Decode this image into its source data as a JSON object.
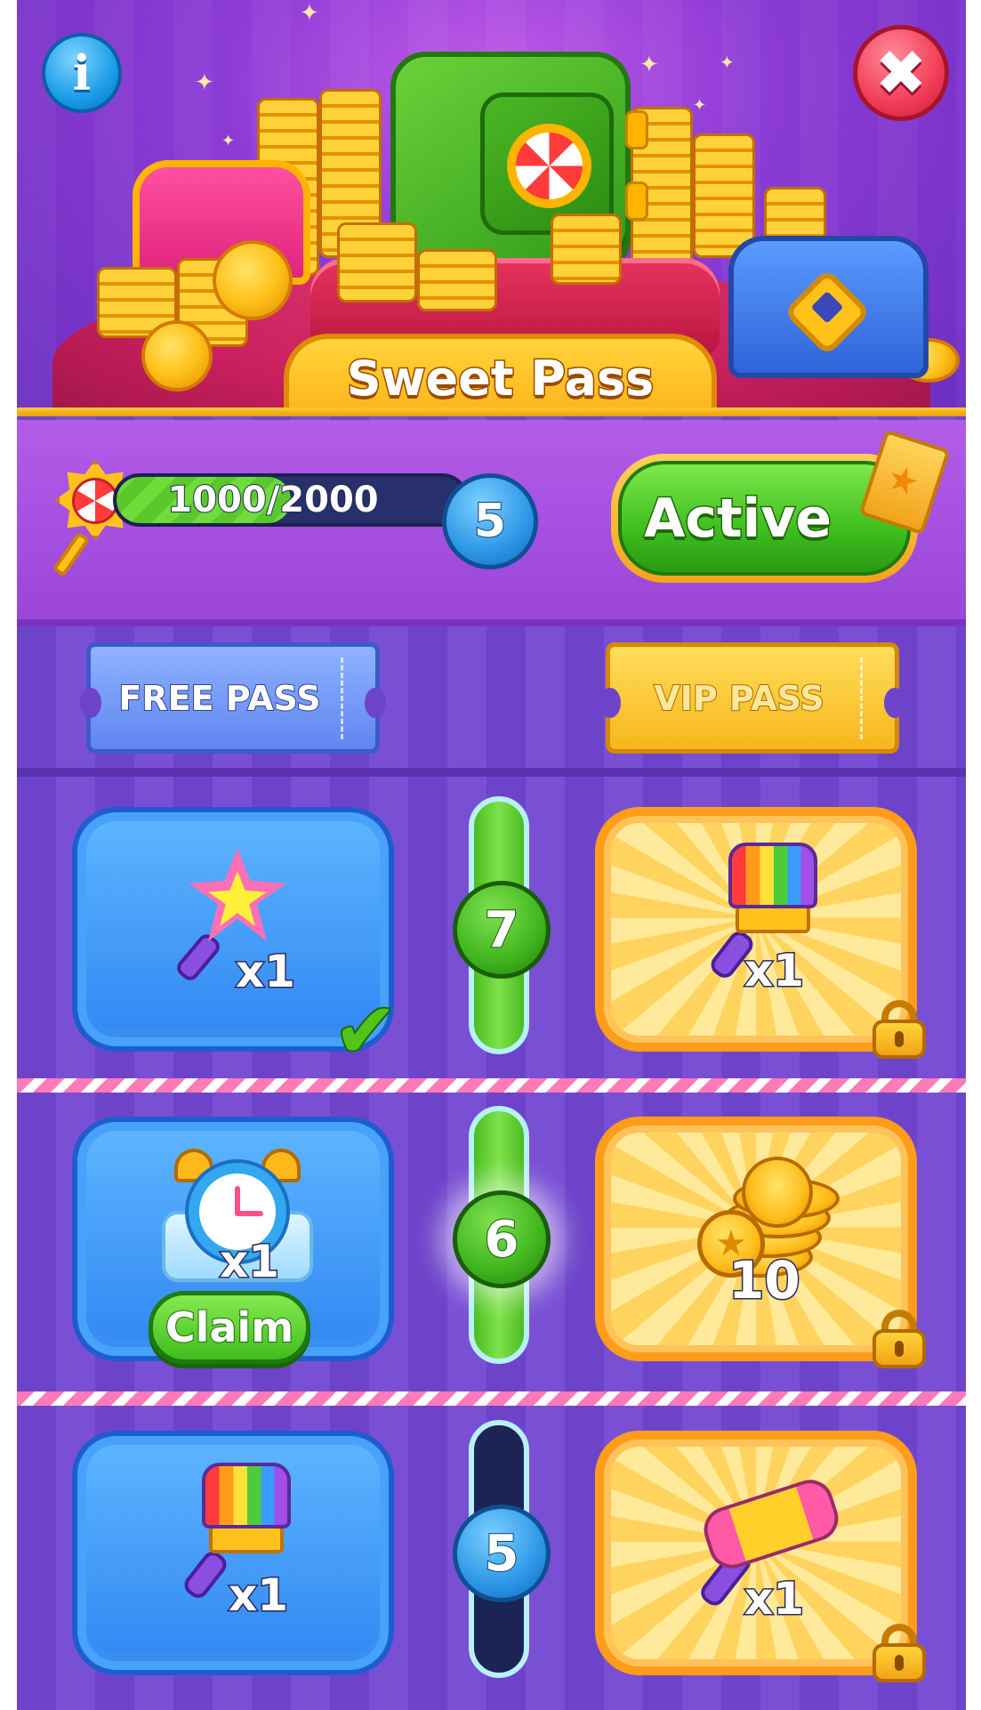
{
  "header": {
    "title": "Sweet Pass",
    "info_icon": "info-icon",
    "close_icon": "close-icon",
    "info_glyph": "i",
    "close_glyph": "✖"
  },
  "progress": {
    "text": "1000/2000",
    "current": 1000,
    "max": 2000,
    "level": "5",
    "key_icon": "candy-key-icon"
  },
  "status_button": {
    "label": "Active",
    "ticket_icon": "golden-ticket-icon"
  },
  "pass_tabs": {
    "free_label": "FREE PASS",
    "vip_label": "VIP PASS"
  },
  "tiers": [
    {
      "level": "7",
      "track_filled": true,
      "free": {
        "item_icon": "star-wand-icon",
        "qty": "x1",
        "state": "claimed"
      },
      "vip": {
        "item_icon": "rainbow-paintbrush-icon",
        "qty": "x1",
        "locked": true
      }
    },
    {
      "level": "6",
      "track_filled": true,
      "free": {
        "item_icon": "frozen-alarm-clock-icon",
        "qty": "x1",
        "state": "claimable",
        "claim_label": "Claim"
      },
      "vip": {
        "item_icon": "gold-coins-icon",
        "qty": "10",
        "locked": true
      }
    },
    {
      "level": "5",
      "track_filled": false,
      "free": {
        "item_icon": "rainbow-paintbrush-icon",
        "qty": "x1",
        "state": "available"
      },
      "vip": {
        "item_icon": "candy-hammer-icon",
        "qty": "x1",
        "locked": true
      }
    }
  ],
  "colors": {
    "background_purple": "#6d44c9",
    "free_card_blue": "#2f86f2",
    "vip_card_gold": "#ffd45e",
    "progress_green": "#5ac82b",
    "close_red": "#f23c57"
  }
}
